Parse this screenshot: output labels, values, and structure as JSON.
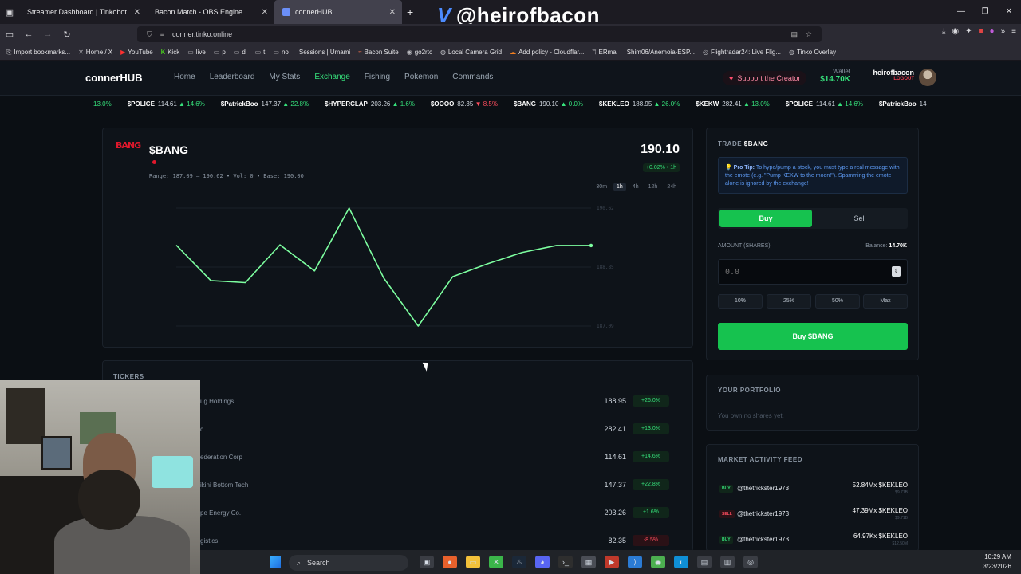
{
  "browser": {
    "tabs": [
      {
        "title": "Streamer Dashboard | Tinkobot",
        "active": false
      },
      {
        "title": "Bacon Match - OBS Engine",
        "active": false
      },
      {
        "title": "connerHUB",
        "active": true
      }
    ],
    "url": "conner.tinko.online",
    "bookmarks": [
      "Import bookmarks...",
      "Home / X",
      "YouTube",
      "Kick",
      "live",
      "p",
      "dl",
      "t",
      "no",
      "Sessions | Umami",
      "Bacon Suite",
      "go2rtc",
      "Local Camera Grid",
      "Add policy - Cloudflar...",
      "ERma",
      "Shim06/Anemoia-ESP...",
      "Flightradar24: Live Flig...",
      "Tinko Overlay"
    ]
  },
  "stream_overlay": {
    "handle": "@heirofbacon"
  },
  "site": {
    "brand": "connerHUB",
    "menu": [
      "Home",
      "Leaderboard",
      "My Stats",
      "Exchange",
      "Fishing",
      "Pokemon",
      "Commands"
    ],
    "active_menu": "Exchange",
    "support_label": "Support the Creator",
    "wallet_label": "Wallet",
    "wallet_amount": "$14.70K",
    "username": "heirofbacon",
    "logout": "LOGOUT"
  },
  "ticker_strip": [
    {
      "sym": "",
      "price": "",
      "chg": "13.0%",
      "dir": "up"
    },
    {
      "sym": "$POLICE",
      "price": "114.61",
      "chg": "14.6%",
      "dir": "up"
    },
    {
      "sym": "$PatrickBoo",
      "price": "147.37",
      "chg": "22.8%",
      "dir": "up"
    },
    {
      "sym": "$HYPERCLAP",
      "price": "203.26",
      "chg": "1.6%",
      "dir": "up"
    },
    {
      "sym": "$OOOO",
      "price": "82.35",
      "chg": "8.5%",
      "dir": "dn"
    },
    {
      "sym": "$BANG",
      "price": "190.10",
      "chg": "0.0%",
      "dir": "up"
    },
    {
      "sym": "$KEKLEO",
      "price": "188.95",
      "chg": "26.0%",
      "dir": "up"
    },
    {
      "sym": "$KEKW",
      "price": "282.41",
      "chg": "13.0%",
      "dir": "up"
    },
    {
      "sym": "$POLICE",
      "price": "114.61",
      "chg": "14.6%",
      "dir": "up"
    },
    {
      "sym": "$PatrickBoo",
      "price": "14",
      "chg": "",
      "dir": "up"
    }
  ],
  "stock": {
    "logo_text": "BANG",
    "symbol": "$BANG",
    "meta": "Range: 187.09 — 190.62  •  Vol: 0  •  Base: 190.00",
    "price": "190.10",
    "change": "+0.02% • 1h",
    "ranges": [
      "30m",
      "1h",
      "4h",
      "12h",
      "24h"
    ],
    "active_range": "1h"
  },
  "chart_data": {
    "type": "line",
    "title": "",
    "xlabel": "",
    "ylabel": "",
    "ylim": [
      187.09,
      190.62
    ],
    "y_ticks": [
      "190.62",
      "188.85",
      "187.09"
    ],
    "grid": true,
    "series": [
      {
        "values": [
          189.51,
          188.45,
          188.39,
          189.52,
          188.74,
          190.62,
          188.53,
          187.09,
          188.57,
          188.95,
          189.29,
          189.5,
          189.5
        ]
      }
    ],
    "color": "#7dffa0"
  },
  "tickers": {
    "title": "TICKERS",
    "rows": [
      {
        "name": "ug Holdings",
        "price": "188.95",
        "chg": "+26.0%",
        "dir": "up"
      },
      {
        "name": "c.",
        "price": "282.41",
        "chg": "+13.0%",
        "dir": "up"
      },
      {
        "name": "ederation Corp",
        "price": "114.61",
        "chg": "+14.6%",
        "dir": "up"
      },
      {
        "name": "ikini Bottom Tech",
        "price": "147.37",
        "chg": "+22.8%",
        "dir": "up"
      },
      {
        "name": "pe Energy Co.",
        "price": "203.26",
        "chg": "+1.6%",
        "dir": "up"
      },
      {
        "name": "gistics",
        "price": "82.35",
        "chg": "-8.5%",
        "dir": "dn"
      }
    ]
  },
  "trade": {
    "title_prefix": "TRADE",
    "symbol": "$BANG",
    "tip_label": "Pro Tip:",
    "tip_text": "To hype/pump a stock, you must type a real message with the emote (e.g. \"Pump KEKW to the moon!\"). Spamming the emote alone is ignored by the exchange!",
    "buy_tab": "Buy",
    "sell_tab": "Sell",
    "amount_label": "AMOUNT (SHARES)",
    "balance_label": "Balance:",
    "balance_value": "14.70K",
    "amount_placeholder": "0.0",
    "pct_buttons": [
      "10%",
      "25%",
      "50%",
      "Max"
    ],
    "submit": "Buy $BANG"
  },
  "portfolio": {
    "title": "YOUR PORTFOLIO",
    "empty": "You own no shares yet."
  },
  "feed": {
    "title": "MARKET ACTIVITY FEED",
    "rows": [
      {
        "type": "BUY",
        "user": "@thetrickster1973",
        "value": "52.84Mx $KEKLEO",
        "sub": "$9.71B"
      },
      {
        "type": "SELL",
        "user": "@thetrickster1973",
        "value": "47.39Mx $KEKLEO",
        "sub": "$9.71B"
      },
      {
        "type": "BUY",
        "user": "@thetrickster1973",
        "value": "64.97Kx $KEKLEO",
        "sub": "$12.50M"
      }
    ]
  },
  "taskbar": {
    "search": "Search",
    "time": "10:29 AM",
    "date": "8/23/2026"
  }
}
